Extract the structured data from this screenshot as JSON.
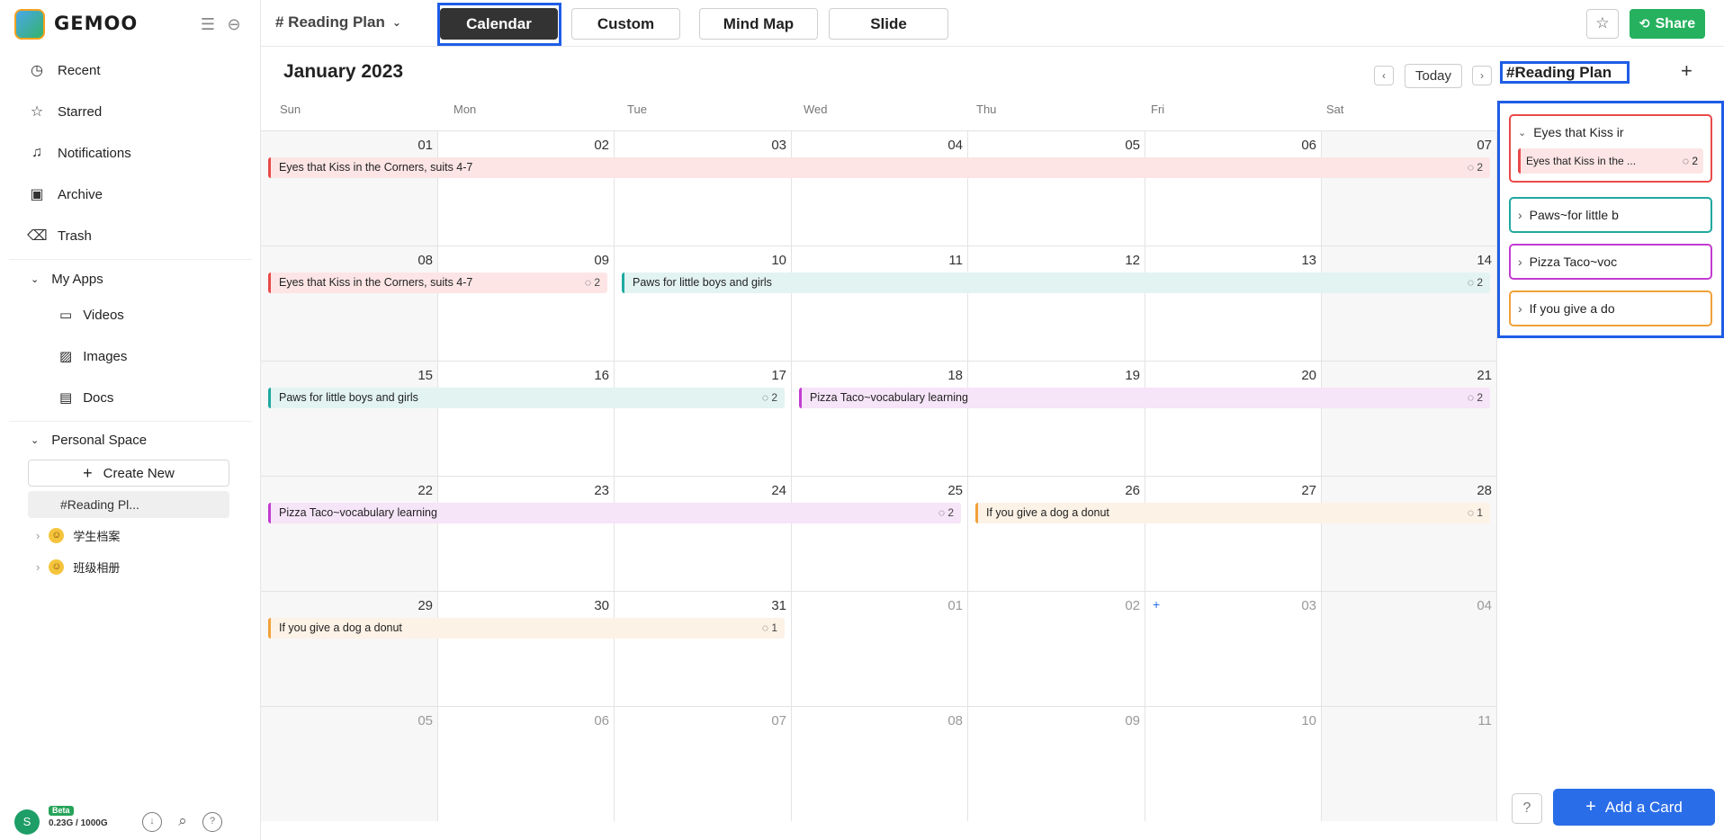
{
  "sidebar": {
    "logo_text": "GEMOO",
    "nav": [
      {
        "label": "Recent",
        "icon": "clock-icon"
      },
      {
        "label": "Starred",
        "icon": "star-icon"
      },
      {
        "label": "Notifications",
        "icon": "bell-icon"
      },
      {
        "label": "Archive",
        "icon": "archive-icon"
      },
      {
        "label": "Trash",
        "icon": "trash-icon"
      }
    ],
    "my_apps_label": "My Apps",
    "apps": [
      {
        "label": "Videos",
        "icon": "video-icon"
      },
      {
        "label": "Images",
        "icon": "image-icon"
      },
      {
        "label": "Docs",
        "icon": "doc-icon"
      }
    ],
    "personal_space_label": "Personal Space",
    "create_new_label": "Create New",
    "current_doc": "#Reading Pl...",
    "folders": [
      "学生档案",
      "班级相册"
    ],
    "user_initial": "S",
    "beta": "Beta",
    "quota": "0.23G / 1000G"
  },
  "topbar": {
    "doc_title": "# Reading Plan",
    "tabs": [
      "Calendar",
      "Custom",
      "Mind Map",
      "Slide"
    ],
    "active_tab": "Calendar",
    "share_label": "Share"
  },
  "calendar": {
    "month_title": "January 2023",
    "today_label": "Today",
    "weekdays": [
      "Sun",
      "Mon",
      "Tue",
      "Wed",
      "Thu",
      "Fri",
      "Sat"
    ],
    "weeks": [
      [
        "01",
        "02",
        "03",
        "04",
        "05",
        "06",
        "07"
      ],
      [
        "08",
        "09",
        "10",
        "11",
        "12",
        "13",
        "14"
      ],
      [
        "15",
        "16",
        "17",
        "18",
        "19",
        "20",
        "21"
      ],
      [
        "22",
        "23",
        "24",
        "25",
        "26",
        "27",
        "28"
      ],
      [
        "29",
        "30",
        "31",
        "01",
        "02",
        "03",
        "04"
      ],
      [
        "05",
        "06",
        "07",
        "08",
        "09",
        "10",
        "11"
      ]
    ],
    "events": [
      {
        "title": "Eyes that Kiss in the Corners, suits 4-7",
        "comments": "2",
        "color": "#e94a4a",
        "bg": "#fde5e5"
      },
      {
        "title": "Paws for little boys and girls",
        "comments": "2",
        "color": "#1fa8a0",
        "bg": "#e2f3f2"
      },
      {
        "title": "Pizza Taco~vocabulary learning",
        "comments": "2",
        "color": "#c23bd1",
        "bg": "#f6e4f8"
      },
      {
        "title": "If you give a dog a donut",
        "comments": "1",
        "color": "#f0a13a",
        "bg": "#fdf2e6"
      }
    ]
  },
  "panel": {
    "title": "#Reading Plan",
    "cards": [
      {
        "title": "Eyes that Kiss ir",
        "expanded": true,
        "color": "#e94a4a",
        "sub": "Eyes that Kiss in the ...",
        "sub_comments": "2"
      },
      {
        "title": "Paws~for little b",
        "expanded": false,
        "color": "#1fa8a0"
      },
      {
        "title": "Pizza Taco~voc",
        "expanded": false,
        "color": "#c23bd1"
      },
      {
        "title": "If you give a do",
        "expanded": false,
        "color": "#f0a13a"
      }
    ],
    "add_card_label": "Add a Card"
  }
}
